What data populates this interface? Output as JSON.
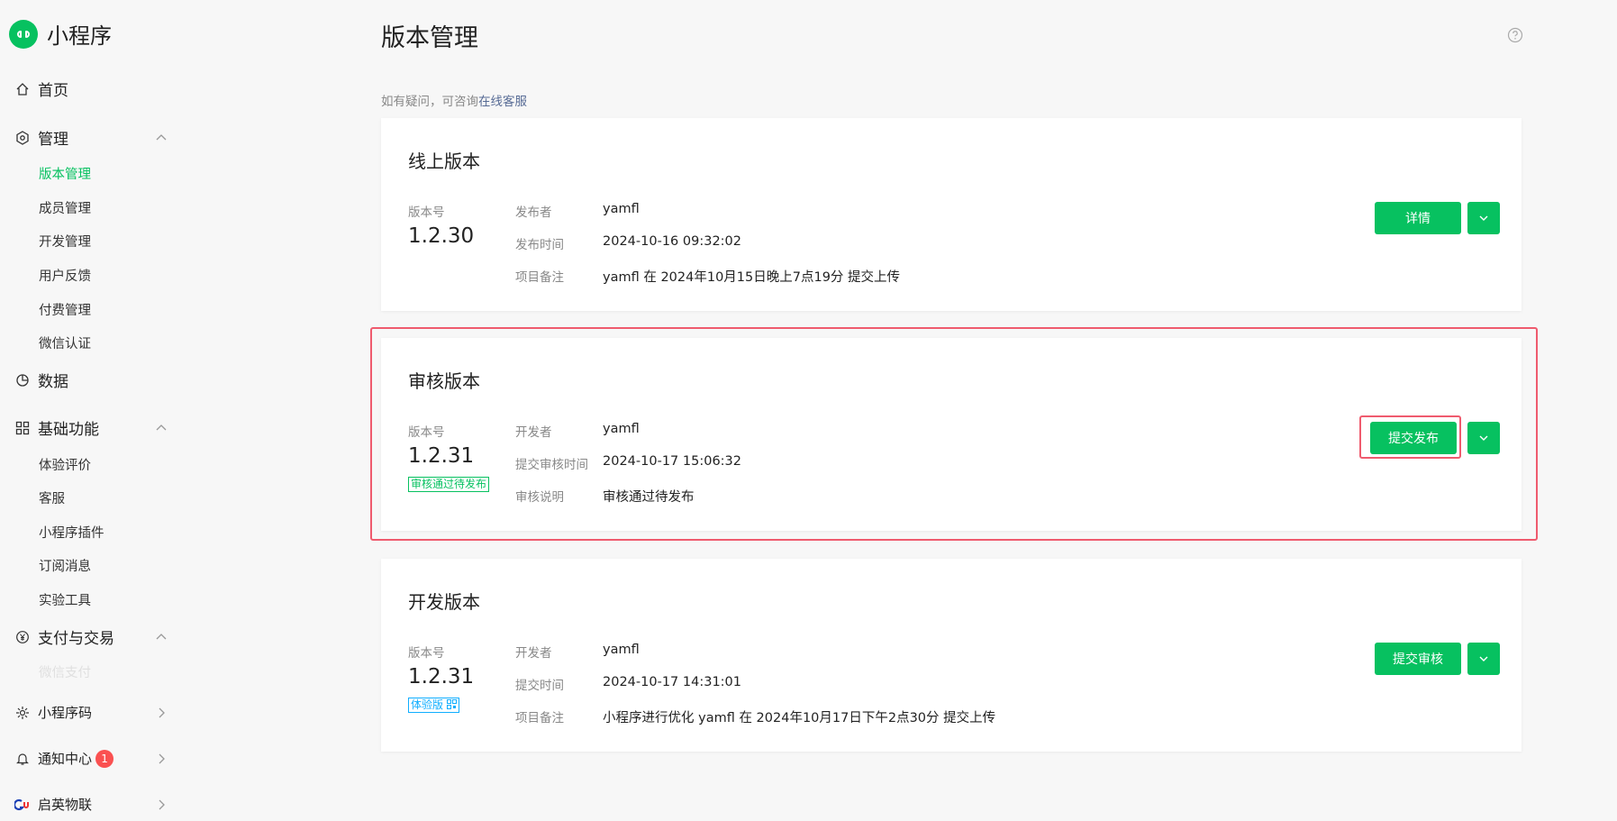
{
  "app": {
    "name": "小程序"
  },
  "sidebar": {
    "home": "首页",
    "manage": {
      "label": "管理",
      "items": [
        "版本管理",
        "成员管理",
        "开发管理",
        "用户反馈",
        "付费管理",
        "微信认证"
      ]
    },
    "data": "数据",
    "basic": {
      "label": "基础功能",
      "items": [
        "体验评价",
        "客服",
        "小程序插件",
        "订阅消息",
        "实验工具"
      ]
    },
    "pay": {
      "label": "支付与交易",
      "items": [
        "微信支付"
      ]
    },
    "qrcode": "小程序码",
    "notify": {
      "label": "通知中心",
      "badge": "1"
    },
    "brand": "启英物联"
  },
  "main": {
    "title": "版本管理",
    "hint_prefix": "如有疑问，可咨询",
    "hint_link": "在线客服"
  },
  "cards": [
    {
      "title": "线上版本",
      "version_label": "版本号",
      "version": "1.2.30",
      "rows": [
        {
          "label": "发布者",
          "value": "yamfl"
        },
        {
          "label": "发布时间",
          "value": "2024-10-16 09:32:02"
        },
        {
          "label": "项目备注",
          "value": "yamfl 在 2024年10月15日晚上7点19分 提交上传"
        }
      ],
      "button": "详情"
    },
    {
      "title": "审核版本",
      "version_label": "版本号",
      "version": "1.2.31",
      "tag": "审核通过待发布",
      "rows": [
        {
          "label": "开发者",
          "value": "yamfl"
        },
        {
          "label": "提交审核时间",
          "value": "2024-10-17 15:06:32"
        },
        {
          "label": "审核说明",
          "value": "审核通过待发布"
        }
      ],
      "button": "提交发布"
    },
    {
      "title": "开发版本",
      "version_label": "版本号",
      "version": "1.2.31",
      "tag": "体验版",
      "rows": [
        {
          "label": "开发者",
          "value": "yamfl"
        },
        {
          "label": "提交时间",
          "value": "2024-10-17 14:31:01"
        },
        {
          "label": "项目备注",
          "value": "小程序进行优化 yamfl 在 2024年10月17日下午2点30分 提交上传"
        }
      ],
      "button": "提交审核"
    }
  ],
  "colors": {
    "accent": "#07c160",
    "highlight": "#ef5b6e",
    "badge": "#fa5151",
    "link": "#576b95",
    "tag_blue": "#10aeff"
  }
}
